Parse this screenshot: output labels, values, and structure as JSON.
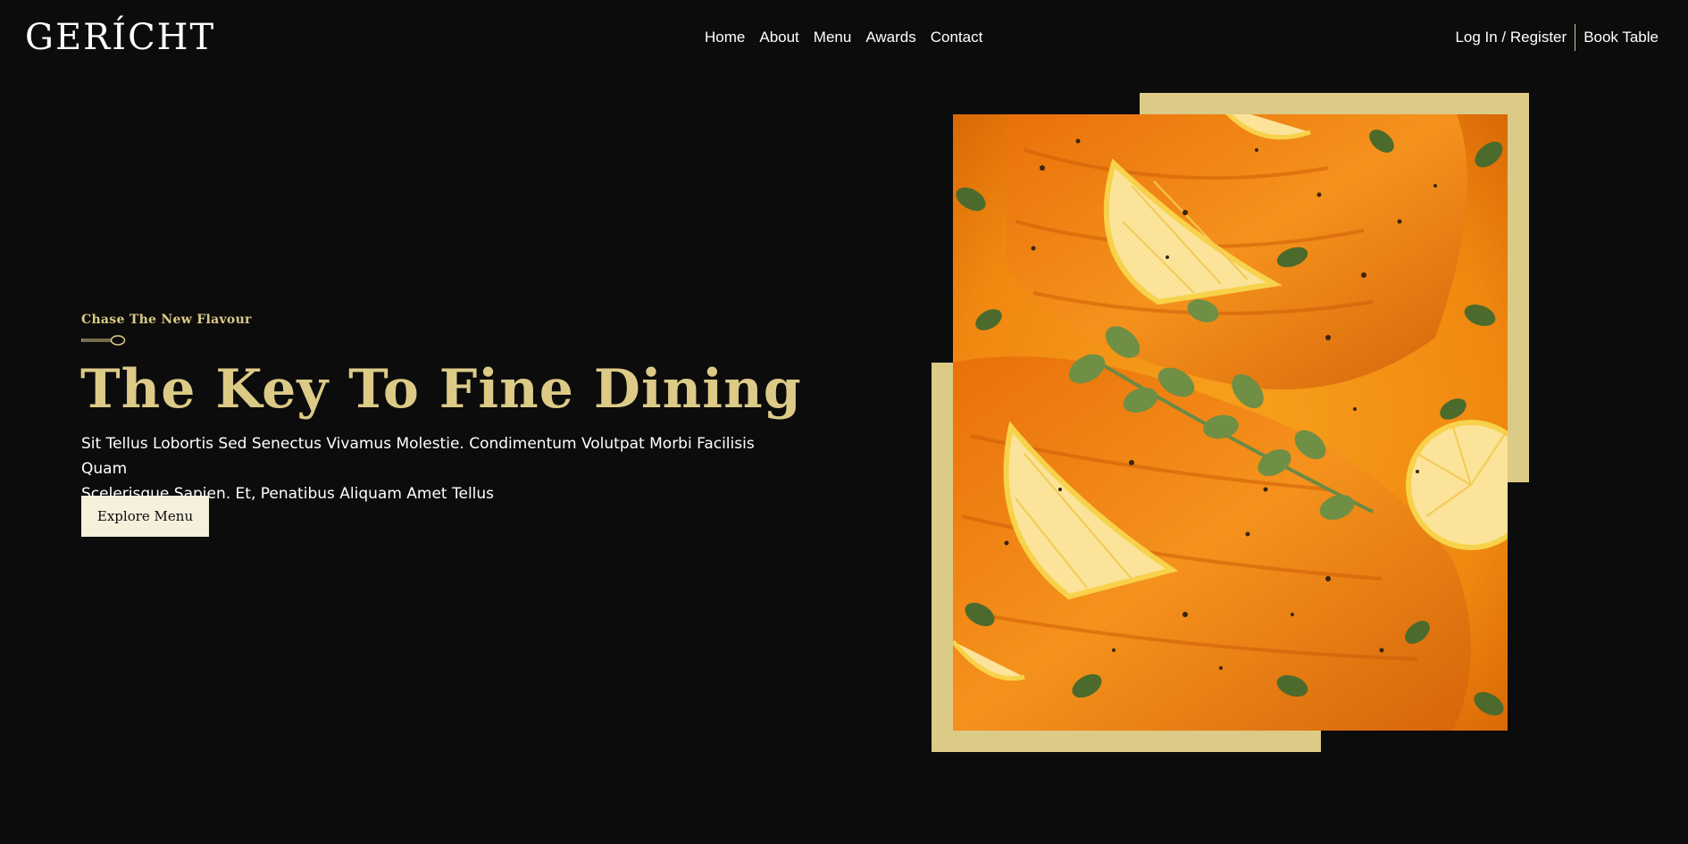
{
  "navbar": {
    "logo": "GERÍCHT",
    "links": [
      "Home",
      "About",
      "Menu",
      "Awards",
      "Contact"
    ],
    "login": "Log In / Register",
    "book": "Book Table"
  },
  "hero": {
    "subtitle": "Chase The New Flavour",
    "title": "The Key To Fine Dining",
    "description_line1": "Sit Tellus Lobortis Sed Senectus Vivamus Molestie. Condimentum Volutpat Morbi Facilisis Quam",
    "description_line2": "Scelerisque Sapien. Et, Penatibus Aliquam Amet Tellus",
    "button": "Explore Menu"
  },
  "icons": {
    "spoon": "spoon-icon"
  },
  "colors": {
    "background": "#0c0c0c",
    "gold": "#dcca87",
    "cream": "#f5efdb",
    "white": "#ffffff"
  }
}
